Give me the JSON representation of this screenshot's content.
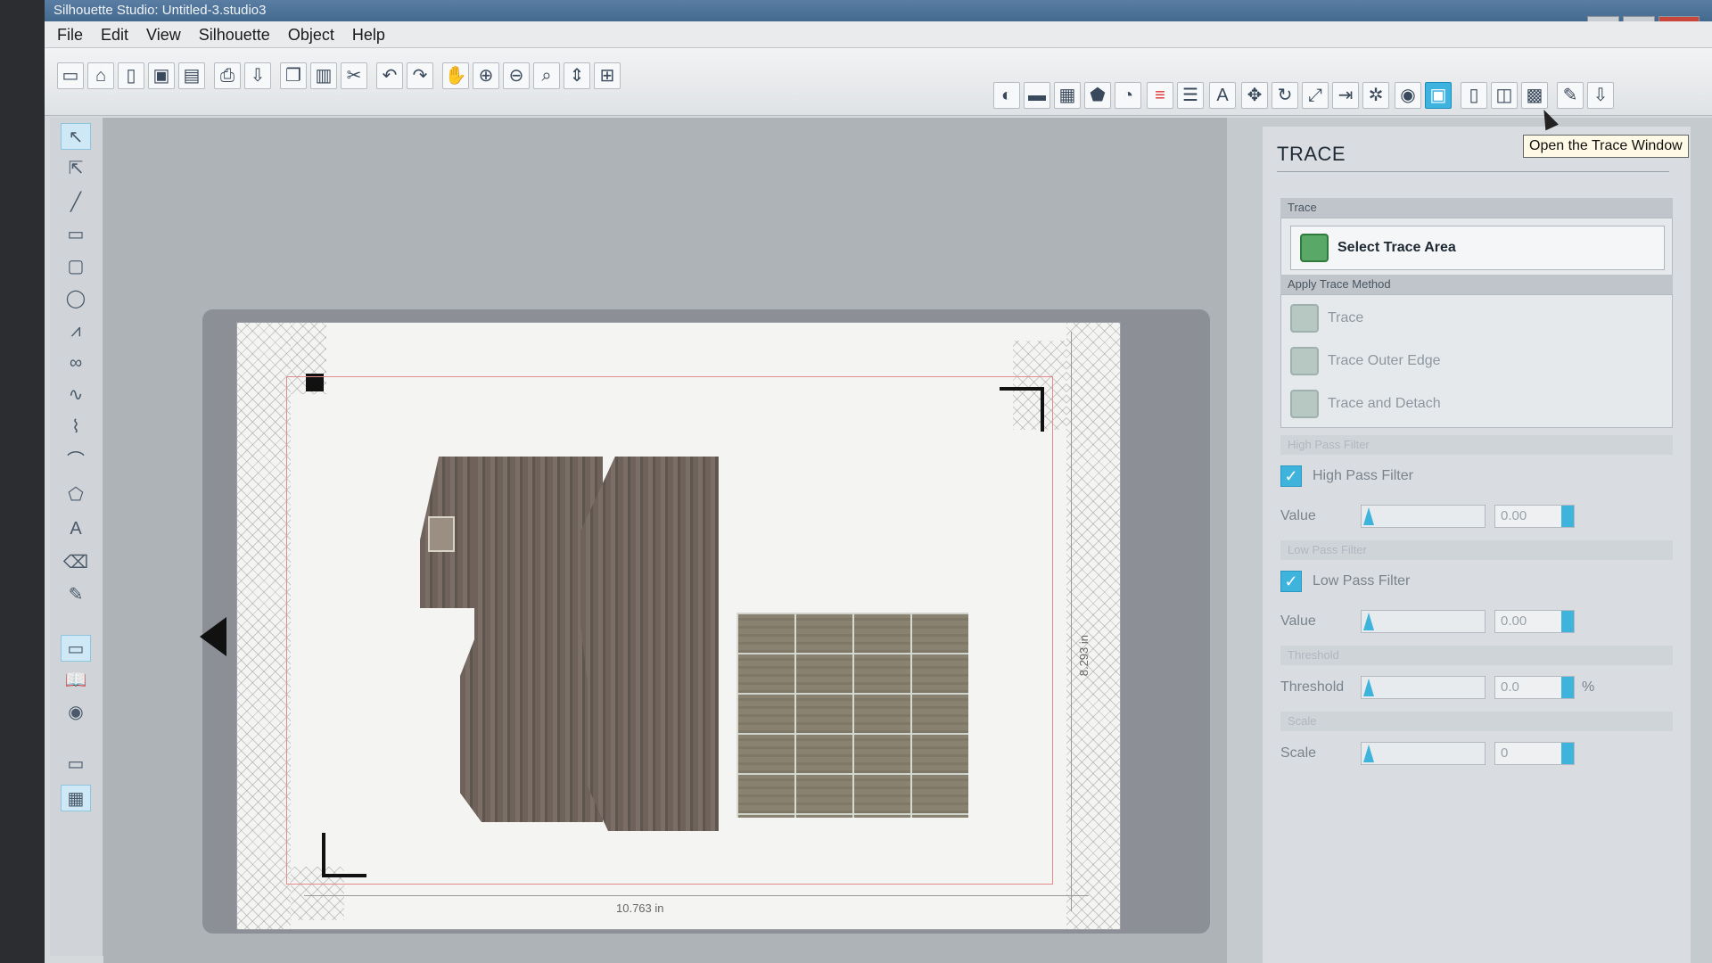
{
  "window": {
    "title": "Silhouette Studio: Untitled-3.studio3",
    "controls": [
      "–",
      "▭",
      "✕"
    ]
  },
  "menubar": [
    "File",
    "Edit",
    "View",
    "Silhouette",
    "Object",
    "Help"
  ],
  "toolbar": {
    "left_icons": [
      "new-icon",
      "open-icon",
      "template-icon",
      "save-icon",
      "save-library-icon",
      "print-icon",
      "send-to-cutter-icon",
      "copy-icon",
      "paste-icon",
      "cut-icon",
      "undo-icon",
      "redo-icon",
      "pan-icon",
      "zoom-in-icon",
      "zoom-out-icon",
      "zoom-select-icon",
      "zoom-fit-icon",
      "fit-page-icon"
    ],
    "right_icons": [
      "fill-icon",
      "line-color-icon",
      "gradient-icon",
      "pattern-icon",
      "shadow-icon",
      "line-style-icon",
      "align-icon",
      "text-style-icon",
      "transform-icon",
      "rotate-icon",
      "scale-icon",
      "move-icon",
      "replicate-icon",
      "modify-icon",
      "offset-icon",
      "trace-icon",
      "page-setup-icon",
      "registration-icon",
      "grid-icon",
      "library-icon",
      "cut-settings-icon"
    ],
    "selected": "trace-icon"
  },
  "tooltip": "Open the Trace Window",
  "canvas": {
    "width_label": "10.763 in",
    "height_label": "8.293 in"
  },
  "trace_panel": {
    "title": "TRACE",
    "trace_section": "Trace",
    "select_button": "Select Trace Area",
    "apply_section": "Apply Trace Method",
    "methods": [
      "Trace",
      "Trace Outer Edge",
      "Trace and Detach"
    ],
    "high_pass": {
      "section": "High Pass Filter",
      "label": "High Pass Filter",
      "checked": true,
      "value_label": "Value",
      "value": "0.00"
    },
    "low_pass": {
      "section": "Low Pass Filter",
      "label": "Low Pass Filter",
      "checked": true,
      "value_label": "Value",
      "value": "0.00"
    },
    "threshold": {
      "section": "Threshold",
      "label": "Threshold",
      "value": "0.0",
      "unit": "%"
    },
    "scale": {
      "section": "Scale",
      "label": "Scale",
      "value": "0"
    }
  }
}
